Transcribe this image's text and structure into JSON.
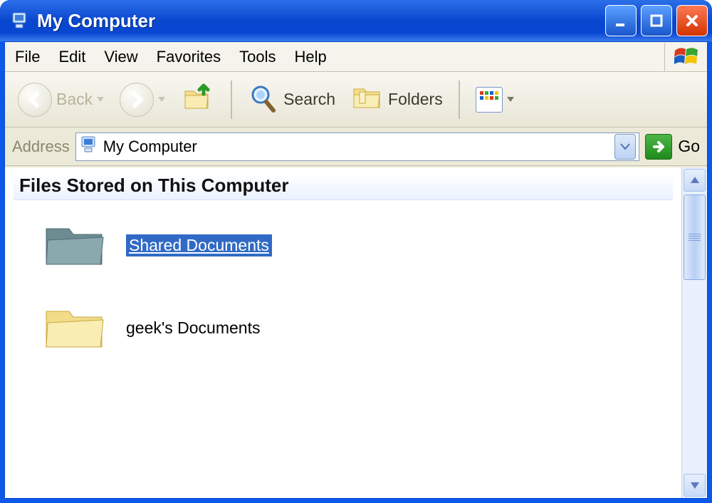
{
  "window": {
    "title": "My Computer"
  },
  "menubar": {
    "file": "File",
    "edit": "Edit",
    "view": "View",
    "favorites": "Favorites",
    "tools": "Tools",
    "help": "Help"
  },
  "toolbar": {
    "back": "Back",
    "search": "Search",
    "folders": "Folders"
  },
  "addressbar": {
    "label": "Address",
    "value": "My Computer",
    "go": "Go"
  },
  "content": {
    "section_header": "Files Stored on This Computer",
    "folders": [
      {
        "label": "Shared Documents",
        "selected": true
      },
      {
        "label": "geek's Documents",
        "selected": false
      }
    ]
  }
}
